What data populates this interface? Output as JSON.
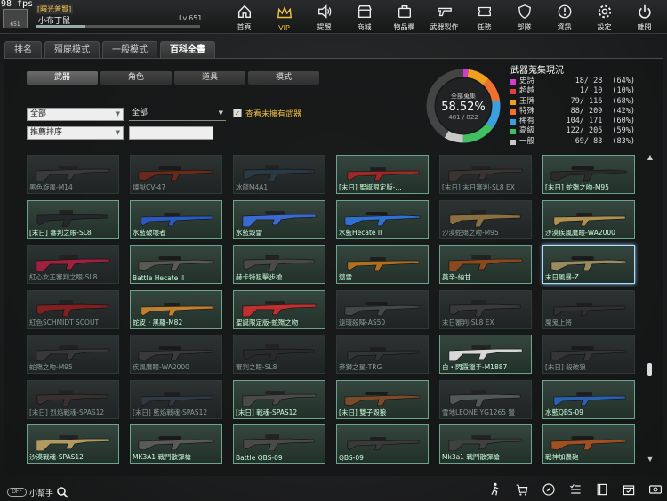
{
  "fps": "98 fps",
  "player": {
    "rank": "[曙光普賢]",
    "name": "小布丁鼠",
    "level": "Lv.651",
    "avatar_label": "651",
    "xp_fraction": 0.3
  },
  "nav": [
    {
      "label": "首頁",
      "icon": "home-icon"
    },
    {
      "label": "VIP",
      "icon": "crown-icon"
    },
    {
      "label": "提醒",
      "icon": "speaker-icon"
    },
    {
      "label": "商城",
      "icon": "shop-icon"
    },
    {
      "label": "物品欄",
      "icon": "bag-icon"
    },
    {
      "label": "武器製作",
      "icon": "gun-icon"
    },
    {
      "label": "任務",
      "icon": "ticket-icon"
    },
    {
      "label": "部隊",
      "icon": "shield-icon"
    },
    {
      "label": "資訊",
      "icon": "info-icon"
    },
    {
      "label": "設定",
      "icon": "gear-icon"
    },
    {
      "label": "離開",
      "icon": "power-icon"
    }
  ],
  "tabs": [
    "排名",
    "殭屍模式",
    "一般模式",
    "百科全書"
  ],
  "subtabs": [
    "武器",
    "角色",
    "道具",
    "模式"
  ],
  "filters": {
    "category": "全部",
    "subcategory": "全部",
    "sort": "推薦排序",
    "search": "",
    "unowned_label": "查看未擁有武器",
    "unowned_checked": true
  },
  "collection": {
    "title": "全部蒐集",
    "percent": "58.52%",
    "count": "481 / 822",
    "fraction": 0.5852
  },
  "stats_title": "武器蒐集現況",
  "stats": [
    {
      "name": "史詩",
      "count": "18/ 28",
      "pct": "(64%)",
      "color": "#d23bd2",
      "fraction": 0.64
    },
    {
      "name": "超越",
      "count": "1/ 10",
      "pct": "(10%)",
      "color": "#e04040",
      "fraction": 0.1
    },
    {
      "name": "王牌",
      "count": "79/ 116",
      "pct": "(68%)",
      "color": "#f0a020",
      "fraction": 0.68
    },
    {
      "name": "特殊",
      "count": "88/ 209",
      "pct": "(42%)",
      "color": "#f07030",
      "fraction": 0.42
    },
    {
      "name": "稀有",
      "count": "104/ 171",
      "pct": "(60%)",
      "color": "#3aa0e0",
      "fraction": 0.6
    },
    {
      "name": "高級",
      "count": "122/ 205",
      "pct": "(59%)",
      "color": "#40c060",
      "fraction": 0.59
    },
    {
      "name": "一般",
      "count": "69/ 83",
      "pct": "(83%)",
      "color": "#c8c8c8",
      "fraction": 0.83
    }
  ],
  "weapons": [
    {
      "name": "黑色旋風-M14",
      "owned": false,
      "color": "#3a3a3a"
    },
    {
      "name": "煉獄CV-47",
      "owned": false,
      "color": "#6a2a1a"
    },
    {
      "name": "冰龍M4A1",
      "owned": false,
      "color": "#2a3a45"
    },
    {
      "name": "[末日] 聖誕限定版-...",
      "owned": true,
      "color": "#a02828"
    },
    {
      "name": "[末日] 末日審判-SL8 EX",
      "owned": false,
      "color": "#3a3530"
    },
    {
      "name": "[末日] 蛇殤之吻-M95",
      "owned": true,
      "color": "#2a2a2a"
    },
    {
      "name": "[末日] 審判之眼-SL8",
      "owned": true,
      "color": "#25282a"
    },
    {
      "name": "水藍破壞者",
      "owned": true,
      "color": "#2a5ac0"
    },
    {
      "name": "水藍毀雷",
      "owned": true,
      "color": "#3a6ad0"
    },
    {
      "name": "水藍Hecate II",
      "owned": true,
      "color": "#3070d0"
    },
    {
      "name": "沙漠蛇殤之吻-M95",
      "owned": false,
      "color": "#8a7040"
    },
    {
      "name": "沙漠疾風鷹眼-WA2000",
      "owned": true,
      "color": "#b09050"
    },
    {
      "name": "紅心女王審判之眼-SL8",
      "owned": false,
      "color": "#a02040"
    },
    {
      "name": "Battle Hecate II",
      "owned": true,
      "color": "#5a5a55"
    },
    {
      "name": "赫卡特狙擊步槍",
      "owned": true,
      "color": "#4a4a48"
    },
    {
      "name": "懲雷",
      "owned": true,
      "color": "#b07020"
    },
    {
      "name": "莫辛-納甘",
      "owned": true,
      "color": "#8a4a20"
    },
    {
      "name": "末日風暴-Z",
      "owned": true,
      "color": "#9a8a60"
    },
    {
      "name": "紅色SCHMIDT SCOUT",
      "owned": false,
      "color": "#802020"
    },
    {
      "name": "蛇皮・黑羅-M82",
      "owned": true,
      "color": "#c08030"
    },
    {
      "name": "聖誕限定版-蛇殤之吻",
      "owned": true,
      "color": "#c03030"
    },
    {
      "name": "遠環殺陣-AS50",
      "owned": false,
      "color": "#404848"
    },
    {
      "name": "末日審判-SL8 EX",
      "owned": false,
      "color": "#3a3a3a"
    },
    {
      "name": "魔鬼上將",
      "owned": false,
      "color": "#303030"
    },
    {
      "name": "蛇殤之吻-M95",
      "owned": false,
      "color": "#383838"
    },
    {
      "name": "疾風鷹眼-WA2000",
      "owned": false,
      "color": "#3a3a3a"
    },
    {
      "name": "審判之眼-SL8",
      "owned": false,
      "color": "#2a2a2a"
    },
    {
      "name": "莽獅之星-TRG",
      "owned": false,
      "color": "#303535"
    },
    {
      "name": "白・閃霞獵手-M1887",
      "owned": true,
      "color": "#d8d8d8"
    },
    {
      "name": "[末日] 殺破狼",
      "owned": false,
      "color": "#353535"
    },
    {
      "name": "[末日] 烈焰戰魂-SPAS12",
      "owned": false,
      "color": "#3a3030"
    },
    {
      "name": "[末日] 藍焰戰魂-SPAS12",
      "owned": false,
      "color": "#303a45"
    },
    {
      "name": "[末日] 戰魂-SPAS12",
      "owned": true,
      "color": "#4a4a4a"
    },
    {
      "name": "[末日] 雙子毀狼",
      "owned": true,
      "color": "#7a4a2a"
    },
    {
      "name": "雪地LEONE YG1265 獵",
      "owned": false,
      "color": "#505858"
    },
    {
      "name": "水藍QBS-09",
      "owned": true,
      "color": "#2a60b0"
    },
    {
      "name": "沙漠戰魂-SPAS12",
      "owned": true,
      "color": "#b09a60"
    },
    {
      "name": "MK3A1 戰鬥散彈槍",
      "owned": true,
      "color": "#5a5a5a"
    },
    {
      "name": "Battle QBS-09",
      "owned": true,
      "color": "#4a4a4a"
    },
    {
      "name": "QBS-09",
      "owned": true,
      "color": "#3a3a3a"
    },
    {
      "name": "Mk3a1 戰鬥散彈槍",
      "owned": true,
      "color": "#404040"
    },
    {
      "name": "戰神加農砲",
      "owned": true,
      "color": "#a05020"
    }
  ],
  "bottom": {
    "helper_label": "小幫手",
    "helper_pill": "OFF",
    "icons": [
      "run-icon",
      "cart-icon",
      "compass-icon",
      "checklist-icon",
      "book-icon",
      "calendar-icon",
      "cash-icon"
    ]
  }
}
